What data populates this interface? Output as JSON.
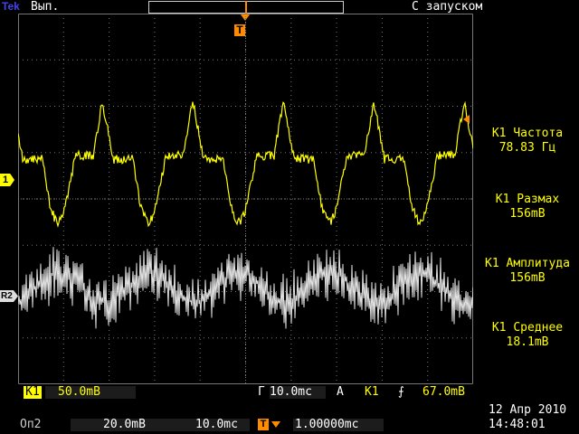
{
  "header": {
    "logo": "Tek",
    "run_state": "Вып.",
    "trigger_mode": "С запуском"
  },
  "markers": {
    "trigger_pos": "T",
    "ch1": "1",
    "ref2": "R2"
  },
  "measurements": [
    {
      "label": "К1 Частота",
      "value": "78.83 Гц"
    },
    {
      "label": "К1 Размах",
      "value": "156mB"
    },
    {
      "label": "К1 Амплитуда",
      "value": "156mB"
    },
    {
      "label": "К1 Среднее",
      "value": "18.1mB"
    }
  ],
  "footer": {
    "ch1_tag": "К1",
    "ch1_scale": "50.0mB",
    "timebase_tag": "Г",
    "timebase": "10.0mc",
    "trig_tag": "A",
    "trig_source": "К1",
    "trig_slope": "⨍",
    "trig_level": "67.0mB",
    "ref_tag": "Оп2",
    "ref_scale": "20.0mB",
    "ref_time": "10.0mc",
    "delay_icon": "T",
    "delay_value": "1.00000mc",
    "date": "12 Апр 2010",
    "time": "14:48:01"
  },
  "colors": {
    "ch1": "#ffff00",
    "ref": "#e0e0e0",
    "accent": "#ff8c00",
    "grid": "#777777"
  },
  "icons": {
    "trigger_marker": "trigger-position-icon",
    "slope": "rising-edge-icon"
  }
}
